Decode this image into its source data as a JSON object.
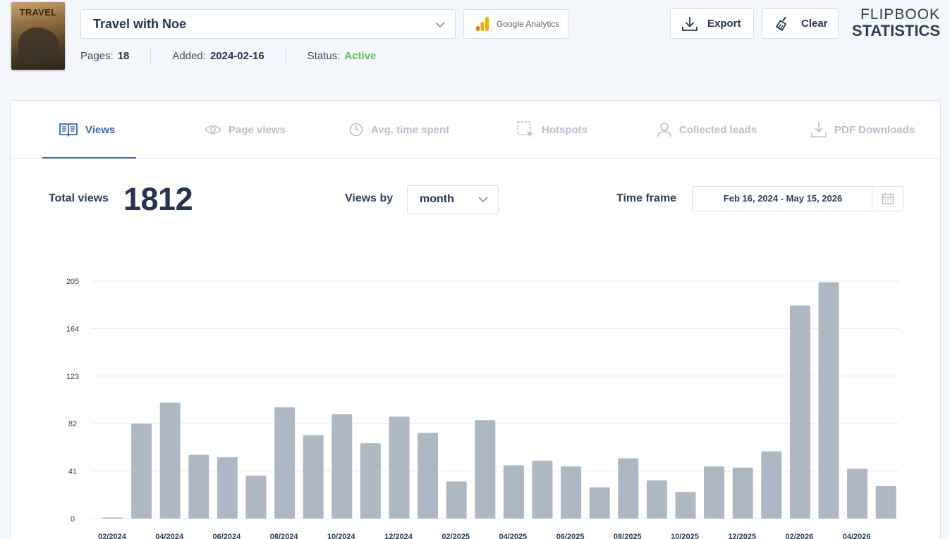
{
  "document": {
    "cover_title": "TRAVEL",
    "name": "Travel with Noe",
    "pages_label": "Pages:",
    "pages_value": "18",
    "added_label": "Added:",
    "added_value": "2024-02-16",
    "status_label": "Status:",
    "status_value": "Active",
    "status_color": "#5cc24e"
  },
  "toolbar": {
    "ga_label": "Google Analytics",
    "export_label": "Export",
    "clear_label": "Clear"
  },
  "brand": {
    "line1": "FLIPBOOK",
    "line2": "STATISTICS"
  },
  "tabs": [
    {
      "label": "Views",
      "icon": "views-icon",
      "active": true
    },
    {
      "label": "Page views",
      "icon": "eye-icon",
      "active": false
    },
    {
      "label": "Avg. time spent",
      "icon": "clock-icon",
      "active": false
    },
    {
      "label": "Hotspots",
      "icon": "hotspot-icon",
      "active": false
    },
    {
      "label": "Collected leads",
      "icon": "user-icon",
      "active": false
    },
    {
      "label": "PDF Downloads",
      "icon": "download-icon",
      "active": false
    }
  ],
  "colors": {
    "accent": "#3d63b8",
    "bar": "#adb8c4",
    "grid": "#e3e8f0"
  },
  "stats": {
    "total_label": "Total views",
    "total_value": "1812",
    "views_by_label": "Views by",
    "views_by_value": "month",
    "timeframe_label": "Time frame",
    "timeframe_value": "Feb 16, 2024 - May 15, 2026"
  },
  "chart_data": {
    "type": "bar",
    "categories": [
      "02/2024",
      "03/2024",
      "04/2024",
      "05/2024",
      "06/2024",
      "07/2024",
      "08/2024",
      "09/2024",
      "10/2024",
      "11/2024",
      "12/2024",
      "01/2025",
      "02/2025",
      "03/2025",
      "04/2025",
      "05/2025",
      "06/2025",
      "07/2025",
      "08/2025",
      "09/2025",
      "10/2025",
      "11/2025",
      "12/2025",
      "01/2026",
      "02/2026",
      "03/2026",
      "04/2026",
      "05/2026"
    ],
    "tick_labels": [
      "02/2024",
      "04/2024",
      "06/2024",
      "08/2024",
      "10/2024",
      "12/2024",
      "02/2025",
      "04/2025",
      "06/2025",
      "08/2025",
      "10/2025",
      "12/2025",
      "02/2026",
      "04/2026"
    ],
    "values": [
      1,
      82,
      100,
      55,
      53,
      37,
      96,
      72,
      90,
      65,
      88,
      74,
      32,
      85,
      46,
      50,
      45,
      27,
      52,
      33,
      23,
      45,
      44,
      58,
      184,
      204,
      43,
      28
    ],
    "yticks": [
      0,
      41,
      82,
      123,
      164,
      205
    ],
    "ylim": [
      0,
      205
    ],
    "grid": true
  }
}
